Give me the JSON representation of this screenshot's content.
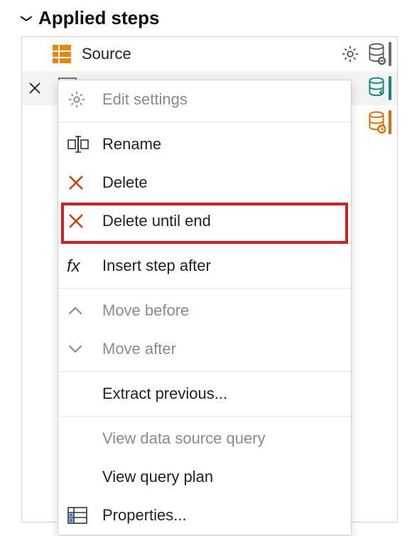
{
  "header": {
    "title": "Applied steps"
  },
  "steps": {
    "source_label": "Source"
  },
  "menu": {
    "edit_settings": "Edit settings",
    "rename": "Rename",
    "delete": "Delete",
    "delete_until_end": "Delete until end",
    "insert_step_after": "Insert step after",
    "move_before": "Move before",
    "move_after": "Move after",
    "extract_previous": "Extract previous...",
    "view_data_source_query": "View data source query",
    "view_query_plan": "View query plan",
    "properties": "Properties..."
  },
  "colors": {
    "orange": "#e6880e",
    "teal": "#0e8a7c",
    "orange_bar": "#e06c00",
    "red": "#d83b01",
    "teal_bar": "#0e8a7c",
    "gray_bar": "#6b6b6b"
  }
}
